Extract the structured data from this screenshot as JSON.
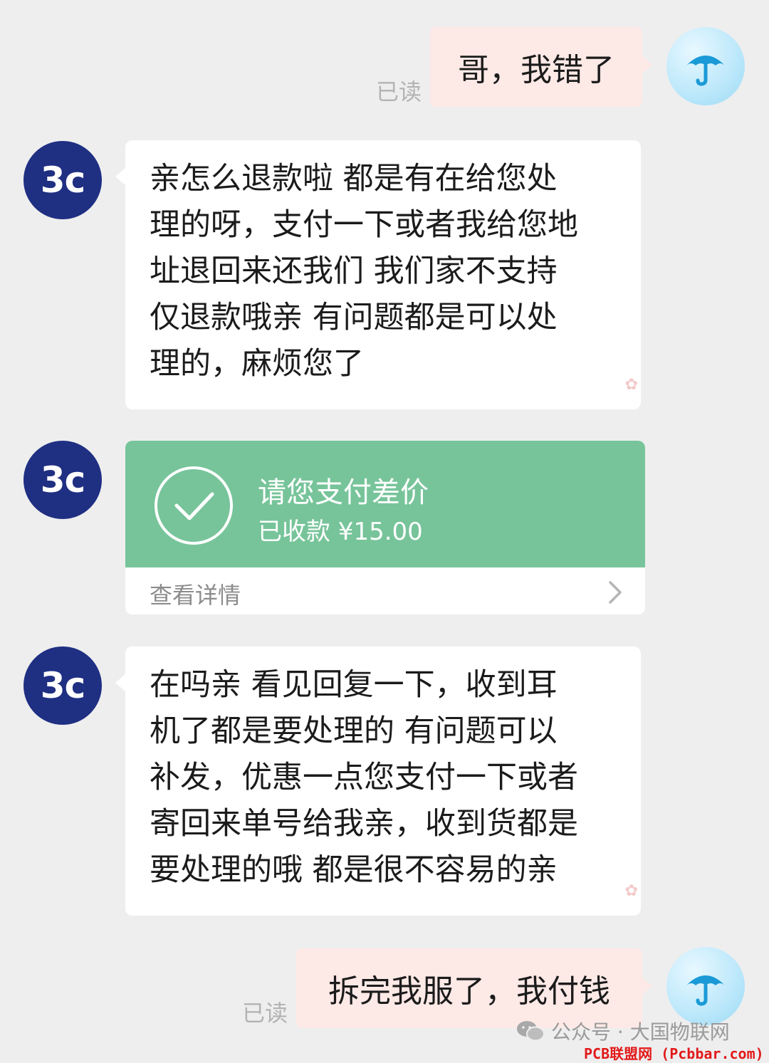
{
  "colors": {
    "background": "#eeeeef",
    "outgoing_bubble": "#fde9e6",
    "incoming_bubble": "#ffffff",
    "shop_avatar": "#1f2f82",
    "payment_card": "#77c49a",
    "read_status": "#b3b3b3",
    "site_watermark": "#e21a1a"
  },
  "shop": {
    "avatar_label": "3c"
  },
  "messages": [
    {
      "direction": "outgoing",
      "text": "哥，我错了",
      "status": "已读"
    },
    {
      "direction": "incoming",
      "lines": [
        "亲怎么退款啦 都是有在给您处",
        "理的呀，支付一下或者我给您地",
        "址退回来还我们 我们家不支持",
        "仅退款哦亲 有问题都是可以处",
        "理的，麻烦您了"
      ]
    },
    {
      "direction": "incoming",
      "type": "payment",
      "title": "请您支付差价",
      "subtitle": "已收款 ¥15.00",
      "link_label": "查看详情",
      "icon": "check-circle-icon"
    },
    {
      "direction": "incoming",
      "lines": [
        "在吗亲 看见回复一下，收到耳",
        "机了都是要处理的 有问题可以",
        "补发，优惠一点您支付一下或者",
        "寄回来单号给我亲，收到货都是",
        "要处理的哦 都是很不容易的亲"
      ]
    },
    {
      "direction": "outgoing",
      "text": "拆完我服了，我付钱",
      "status": "已读"
    }
  ],
  "watermark": {
    "account": "公众号 · 大国物联网",
    "site": "PCB联盟网 (Pcbbar.com)"
  }
}
